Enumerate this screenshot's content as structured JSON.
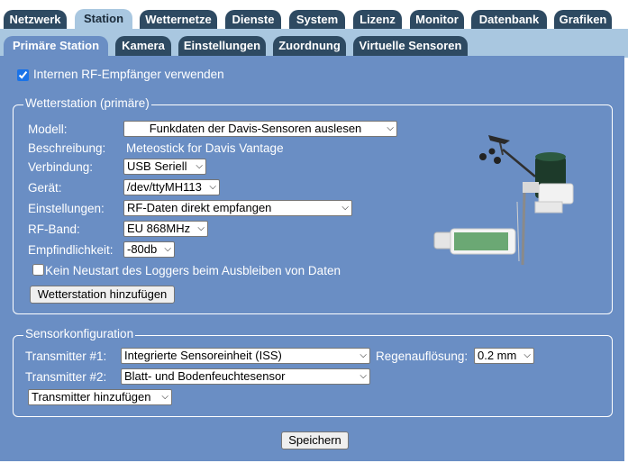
{
  "main_tabs": [
    "Netzwerk",
    "Station",
    "Wetternetze",
    "Dienste",
    "System",
    "Lizenz",
    "Monitor",
    "Datenbank",
    "Grafiken"
  ],
  "sub_tabs": [
    "Primäre Station",
    "Kamera",
    "Einstellungen",
    "Zuordnung",
    "Virtuelle Sensoren"
  ],
  "rf_receiver": {
    "label": "Internen RF-Empfänger verwenden",
    "checked": true
  },
  "weather_station": {
    "legend": "Wetterstation (primäre)",
    "model_label": "Modell:",
    "model_value": "Funkdaten der Davis-Sensoren auslesen",
    "description_label": "Beschreibung:",
    "description_value": "Meteostick for Davis Vantage",
    "connection_label": "Verbindung:",
    "connection_value": "USB Seriell",
    "device_label": "Gerät:",
    "device_value": "/dev/ttyMH113",
    "settings_label": "Einstellungen:",
    "settings_value": "RF-Daten direkt empfangen",
    "rf_band_label": "RF-Band:",
    "rf_band_value": "EU 868MHz",
    "sensitivity_label": "Empfindlichkeit:",
    "sensitivity_value": "-80db",
    "no_restart_label": "Kein Neustart des Loggers beim Ausbleiben von Daten",
    "no_restart_checked": false,
    "add_button": "Wetterstation hinzufügen"
  },
  "sensor_config": {
    "legend": "Sensorkonfiguration",
    "transmitter1_label": "Transmitter #1:",
    "transmitter1_value": "Integrierte Sensoreinheit (ISS)",
    "rain_resolution_label": "Regenauflösung:",
    "rain_resolution_value": "0.2 mm",
    "transmitter2_label": "Transmitter #2:",
    "transmitter2_value": "Blatt- und Bodenfeuchtesensor",
    "add_transmitter": "Transmitter hinzufügen"
  },
  "save_button": "Speichern",
  "colors": {
    "tab_dark": "#2e4a62",
    "tab_band": "#a9c7e0",
    "panel": "#6a8ec4"
  }
}
